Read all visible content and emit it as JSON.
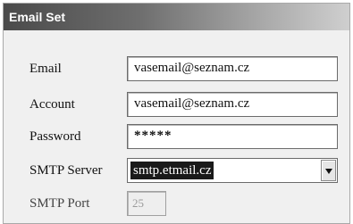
{
  "window": {
    "title": "Email Set"
  },
  "form": {
    "email": {
      "label": "Email",
      "value": "vasemail@seznam.cz"
    },
    "account": {
      "label": "Account",
      "value": "vasemail@seznam.cz"
    },
    "password": {
      "label": "Password",
      "value": "*****"
    },
    "smtp_server": {
      "label": "SMTP Server",
      "selected": "smtp.etmail.cz"
    },
    "smtp_port": {
      "label": "SMTP Port",
      "value": "25",
      "disabled": true
    }
  }
}
